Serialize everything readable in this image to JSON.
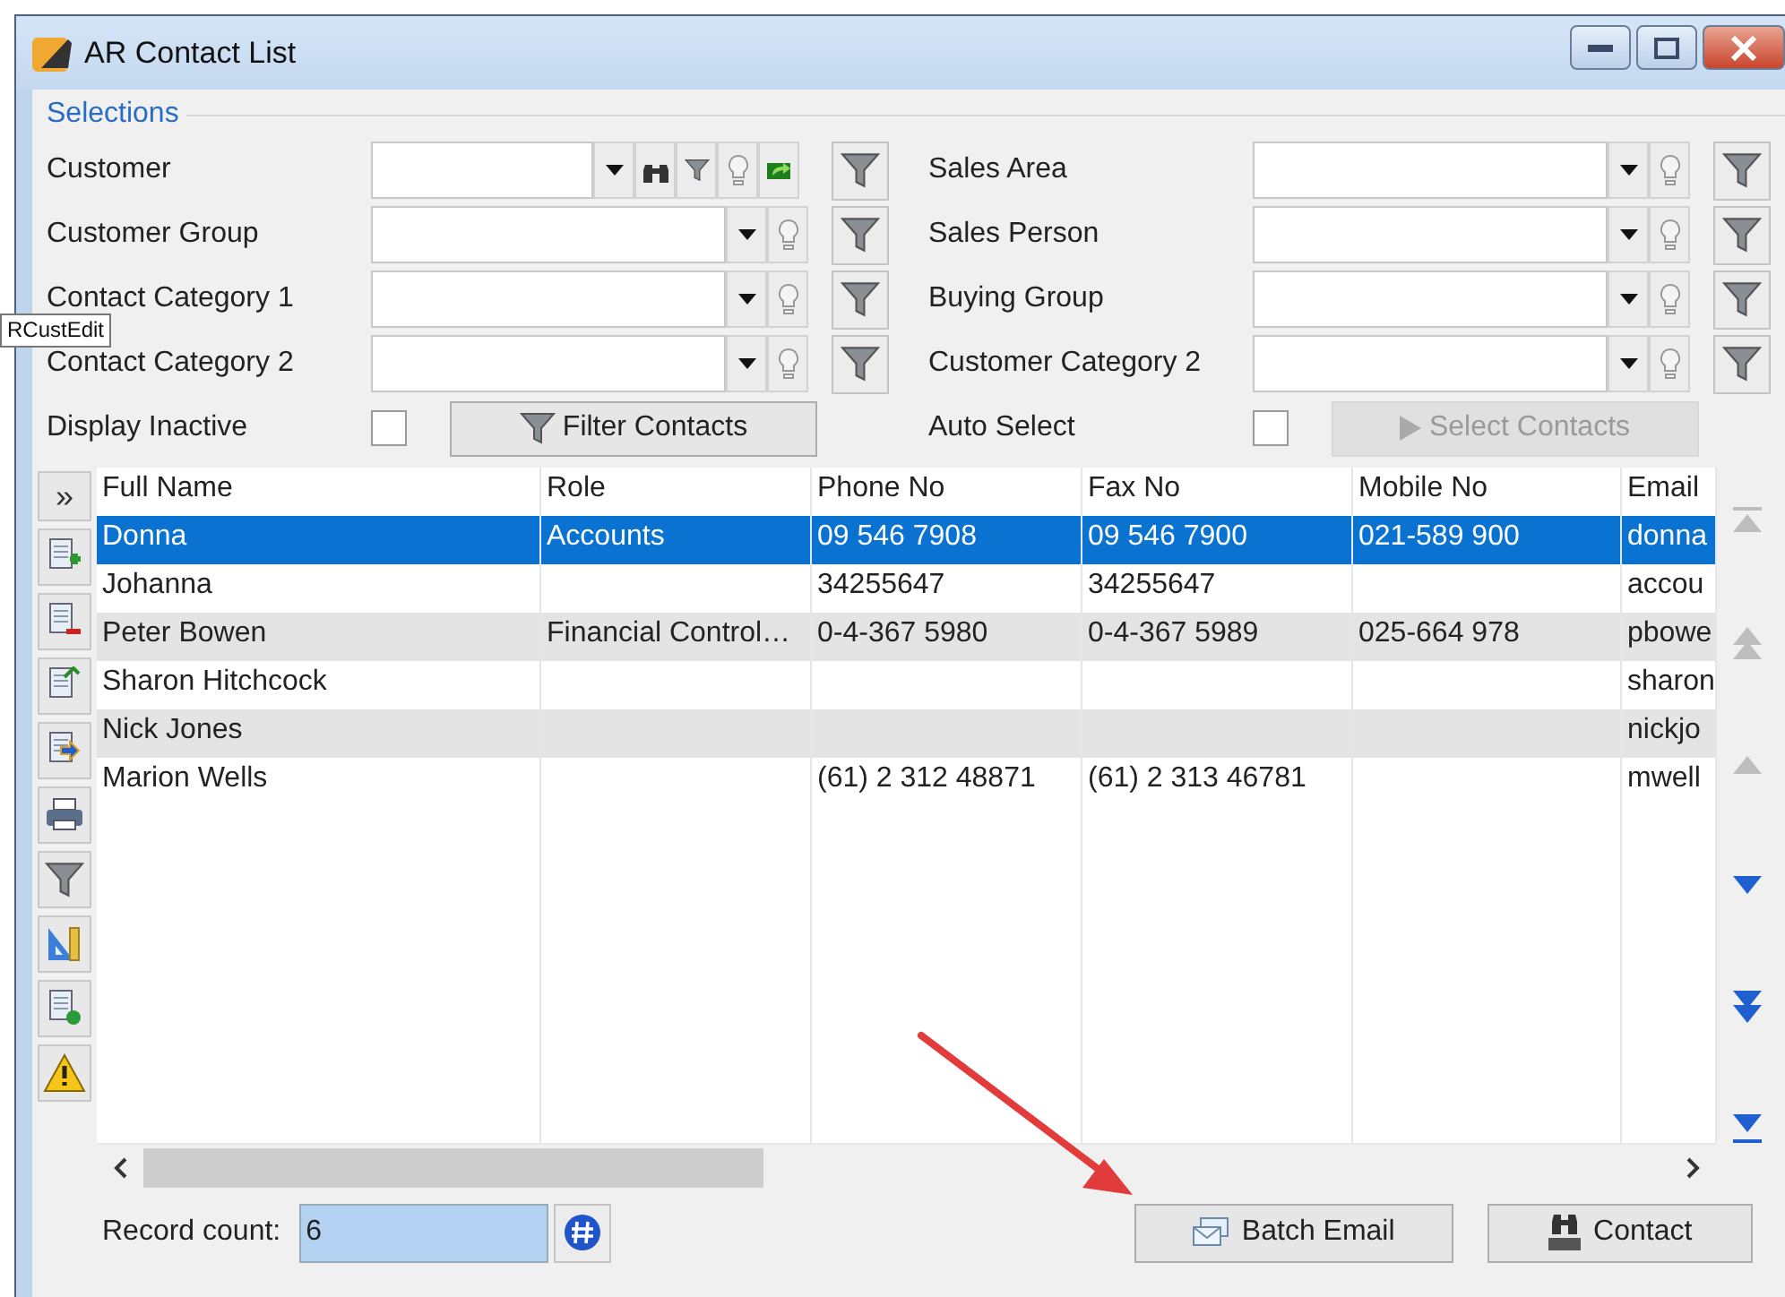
{
  "window": {
    "title": "AR Contact List"
  },
  "selections": {
    "title": "Selections",
    "filters_left": [
      {
        "label": "Customer",
        "kind": "customer"
      },
      {
        "label": "Customer Group",
        "kind": "lookup"
      },
      {
        "label": "Contact Category 1",
        "kind": "lookup"
      },
      {
        "label": "Contact Category 2",
        "kind": "lookup"
      }
    ],
    "filters_right": [
      {
        "label": "Sales Area",
        "kind": "lookup"
      },
      {
        "label": "Sales Person",
        "kind": "lookup"
      },
      {
        "label": "Buying Group",
        "kind": "lookup"
      },
      {
        "label": "Customer Category 2",
        "kind": "lookup"
      }
    ],
    "display_inactive": {
      "label": "Display Inactive",
      "checked": false
    },
    "filter_button": {
      "label": "Filter Contacts",
      "disabled": false
    },
    "auto_select": {
      "label": "Auto Select",
      "checked": false
    },
    "select_button": {
      "label": "Select Contacts",
      "disabled": true
    }
  },
  "tooltip": "RCustEdit",
  "toolbar": {
    "expand": "»"
  },
  "table": {
    "columns": [
      "Full Name",
      "Role",
      "Phone No",
      "Fax No",
      "Mobile No",
      "Email"
    ],
    "rows": [
      {
        "cells": [
          "Donna",
          "Accounts",
          "09 546 7908",
          "09 546 7900",
          "021-589 900",
          "donna"
        ],
        "selected": true
      },
      {
        "cells": [
          "Johanna",
          "",
          "34255647",
          "34255647",
          "",
          "accou"
        ],
        "selected": false
      },
      {
        "cells": [
          "Peter Bowen",
          "Financial Control…",
          "0-4-367 5980",
          "0-4-367 5989",
          "025-664 978",
          "pbowe"
        ],
        "selected": false
      },
      {
        "cells": [
          "Sharon Hitchcock",
          "",
          "",
          "",
          "",
          "sharon"
        ],
        "selected": false
      },
      {
        "cells": [
          "Nick Jones",
          "",
          "",
          "",
          "",
          "nickjo"
        ],
        "selected": false
      },
      {
        "cells": [
          "Marion Wells",
          "",
          "(61) 2 312 48871",
          "(61) 2 313 46781",
          "",
          "mwell"
        ],
        "selected": false
      }
    ]
  },
  "nav_buttons": [
    {
      "kind": "first",
      "disabled": true
    },
    {
      "kind": "page_up",
      "disabled": true
    },
    {
      "kind": "prev",
      "disabled": true
    },
    {
      "kind": "next",
      "disabled": false
    },
    {
      "kind": "page_down",
      "disabled": false
    },
    {
      "kind": "last",
      "disabled": false
    }
  ],
  "footer": {
    "record_count_label": "Record count:",
    "record_count": "6",
    "buttons": [
      {
        "label": "Batch Email",
        "kind": "email"
      },
      {
        "label": "Contact",
        "kind": "contact"
      }
    ]
  }
}
